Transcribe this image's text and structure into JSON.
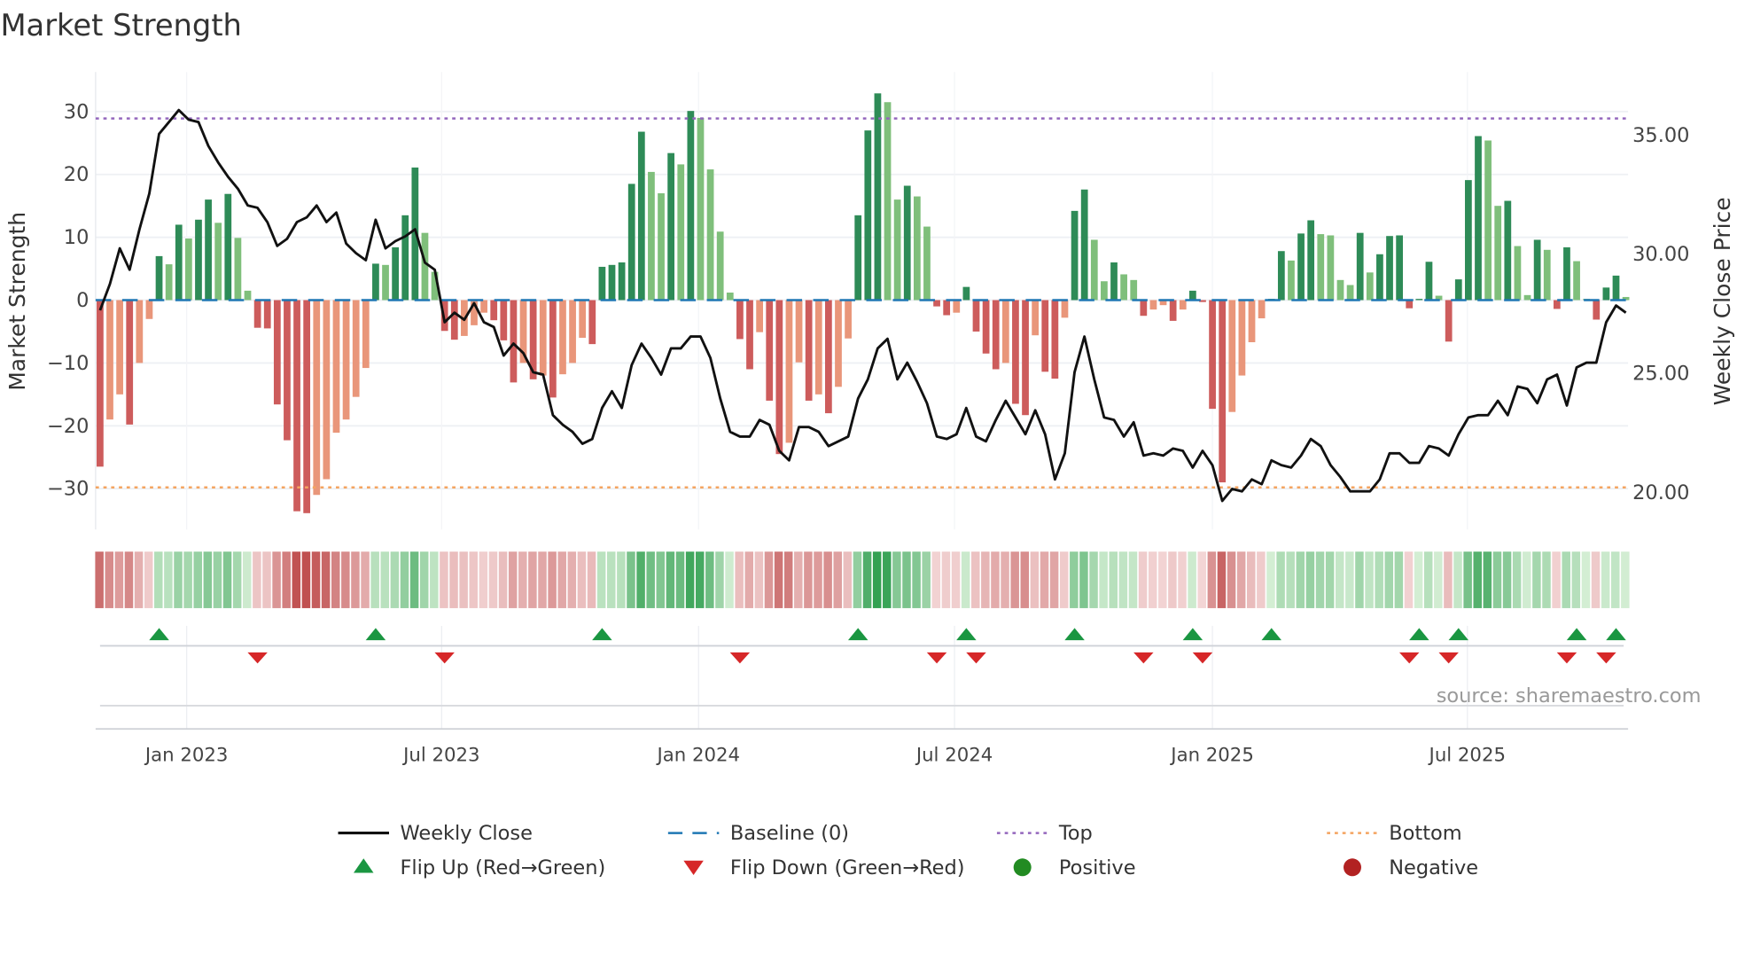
{
  "chart_data": {
    "type": "bar",
    "title": "Market Strength",
    "ylabel": "Market Strength",
    "ylabel_right": "Weekly Close Price",
    "ylim": [
      -36.5,
      36.3
    ],
    "ylim_right": [
      18.4,
      37.6
    ],
    "yticks": [
      30,
      20,
      10,
      0,
      -10,
      -20,
      -30
    ],
    "yticks_labels": [
      "30",
      "20",
      "10",
      "0",
      "−10",
      "−20",
      "−30"
    ],
    "yticks_right": [
      35,
      30,
      25,
      20
    ],
    "yticks_right_labels": [
      "35.00",
      "30.00",
      "25.00",
      "20.00"
    ],
    "x_unit": "week index",
    "xticks": [
      {
        "week": 9.8,
        "label": "Jan 2023"
      },
      {
        "week": 35.7,
        "label": "Jul 2023"
      },
      {
        "week": 61.8,
        "label": "Jan 2024"
      },
      {
        "week": 87.8,
        "label": "Jul 2024"
      },
      {
        "week": 114,
        "label": "Jan 2025"
      },
      {
        "week": 139.9,
        "label": "Jul 2025"
      }
    ],
    "top_level": 28.9,
    "bottom_level": -29.8,
    "baseline": 0,
    "strength": [
      -26.5,
      -19,
      -15,
      -19.8,
      -10,
      -3,
      7,
      5.7,
      12,
      9.8,
      12.8,
      16,
      12.3,
      16.9,
      9.9,
      1.5,
      -4.4,
      -4.5,
      -16.6,
      -22.3,
      -33.6,
      -33.9,
      -31,
      -28.5,
      -21.1,
      -19,
      -15.4,
      -10.8,
      5.8,
      5.6,
      8.4,
      13.5,
      21.1,
      10.7,
      4.5,
      -4.9,
      -6.3,
      -5.7,
      -4,
      -2,
      -3.2,
      -6.4,
      -13.1,
      -10,
      -12.6,
      -12,
      -15.5,
      -11.8,
      -10,
      -6,
      -7,
      5.3,
      5.6,
      6,
      18.5,
      26.8,
      20.4,
      17,
      23.4,
      21.6,
      30.1,
      29,
      20.8,
      10.9,
      1.2,
      -6.2,
      -11,
      -5.1,
      -16,
      -24.5,
      -22.7,
      -9.9,
      -16,
      -15,
      -18,
      -13.8,
      -6.1,
      13.5,
      27,
      32.9,
      31.5,
      16,
      18.2,
      16.5,
      11.7,
      -1,
      -2.4,
      -2,
      2.1,
      -5,
      -8.5,
      -11,
      -10,
      -16.5,
      -18.3,
      -5.6,
      -11.4,
      -12.5,
      -2.8,
      14.2,
      17.6,
      9.6,
      3,
      6,
      4.1,
      3.2,
      -2.5,
      -1.5,
      -0.8,
      -3.3,
      -1.5,
      1.5,
      -0.3,
      -17.3,
      -29,
      -17.8,
      -12,
      -6.7,
      -2.9,
      0.2,
      7.8,
      6.3,
      10.6,
      12.7,
      10.5,
      10.3,
      3.2,
      2.4,
      10.7,
      4.4,
      7.3,
      10.2,
      10.3,
      -1.3,
      0.2,
      6.1,
      0.7,
      -6.6,
      3.3,
      19.1,
      26.1,
      25.4,
      15,
      15.8,
      8.6,
      0.8,
      9.6,
      8,
      -1.4,
      8.4,
      6.2,
      0.2,
      -3.1,
      2,
      3.9,
      0.5
    ],
    "weekly_close": [
      27.6,
      28.7,
      30.2,
      29.3,
      31.0,
      32.5,
      35.0,
      35.5,
      36.0,
      35.6,
      35.5,
      34.5,
      33.8,
      33.2,
      32.7,
      32.0,
      31.9,
      31.3,
      30.3,
      30.6,
      31.3,
      31.5,
      32.0,
      31.3,
      31.7,
      30.4,
      30.0,
      29.7,
      31.4,
      30.2,
      30.5,
      30.7,
      31.0,
      29.6,
      29.3,
      27.1,
      27.5,
      27.2,
      27.9,
      27.1,
      26.9,
      25.7,
      26.2,
      25.8,
      25.0,
      24.9,
      23.2,
      22.8,
      22.5,
      22.0,
      22.2,
      23.5,
      24.2,
      23.5,
      25.3,
      26.2,
      25.6,
      24.9,
      26.0,
      26.0,
      26.5,
      26.5,
      25.6,
      23.9,
      22.5,
      22.3,
      22.3,
      23.0,
      22.8,
      21.7,
      21.3,
      22.7,
      22.7,
      22.5,
      21.9,
      22.1,
      22.3,
      23.9,
      24.7,
      26.0,
      26.4,
      24.7,
      25.4,
      24.6,
      23.7,
      22.3,
      22.2,
      22.4,
      23.5,
      22.3,
      22.1,
      23.0,
      23.8,
      23.1,
      22.4,
      23.4,
      22.4,
      20.5,
      21.6,
      25.0,
      26.5,
      24.7,
      23.1,
      23.0,
      22.3,
      22.9,
      21.5,
      21.6,
      21.5,
      21.8,
      21.7,
      21.0,
      21.7,
      21.1,
      19.6,
      20.1,
      20.0,
      20.5,
      20.3,
      21.3,
      21.1,
      21.0,
      21.5,
      22.2,
      21.9,
      21.1,
      20.6,
      20.0,
      20.0,
      20.0,
      20.5,
      21.6,
      21.6,
      21.2,
      21.2,
      21.9,
      21.8,
      21.5,
      22.4,
      23.1,
      23.2,
      23.2,
      23.8,
      23.2,
      24.4,
      24.3,
      23.7,
      24.7,
      24.9,
      23.6,
      25.2,
      25.4,
      25.4,
      27.1,
      27.8,
      27.5
    ],
    "flip_up_weeks": [
      7,
      29,
      52,
      78,
      89,
      100,
      112,
      120,
      135,
      139,
      151,
      155
    ],
    "flip_down_weeks": [
      17,
      36,
      66,
      86,
      90,
      107,
      113,
      134,
      138,
      150,
      154
    ],
    "colors": {
      "pos_strong": "#2e8b57",
      "pos_weak": "#7fbf7b",
      "neg_strong": "#cd5c5c",
      "neg_weak": "#e9967a",
      "close": "#111111",
      "baseline": "#1f77b4",
      "top": "#9467bd",
      "bottom": "#f4a460",
      "flip_up": "#1a9641",
      "flip_down": "#d62728",
      "positive": "#228b22",
      "negative": "#b22222"
    },
    "legend": [
      {
        "key": "close",
        "label": "Weekly Close",
        "symbol": "line"
      },
      {
        "key": "baseline",
        "label": "Baseline (0)",
        "symbol": "dash"
      },
      {
        "key": "top",
        "label": "Top",
        "symbol": "dot"
      },
      {
        "key": "bottom",
        "label": "Bottom",
        "symbol": "dot"
      },
      {
        "key": "flip_up",
        "label": "Flip Up (Red→Green)",
        "symbol": "up"
      },
      {
        "key": "flip_down",
        "label": "Flip Down (Green→Red)",
        "symbol": "down"
      },
      {
        "key": "positive",
        "label": "Positive",
        "symbol": "circle"
      },
      {
        "key": "negative",
        "label": "Negative",
        "symbol": "circle"
      }
    ],
    "legend_position": "bottom",
    "source": "source: sharemaestro.com"
  }
}
